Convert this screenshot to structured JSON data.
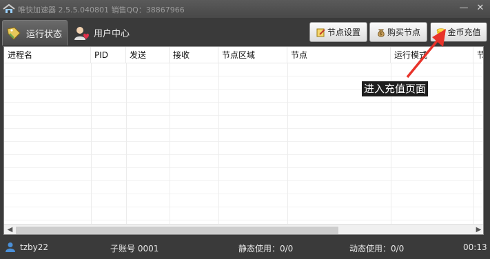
{
  "window": {
    "title": "唯快加速器 2.5.5.040801  销售QQ：38867966",
    "minimize_glyph": "—",
    "close_glyph": "✕"
  },
  "tabs": [
    {
      "label": "运行状态",
      "icon": "tag-icon",
      "active": true
    },
    {
      "label": "用户中心",
      "icon": "user-heart-icon",
      "active": false
    }
  ],
  "toolbar": {
    "node_settings": "节点设置",
    "buy_nodes": "购买节点",
    "gold_recharge": "金币充值"
  },
  "table": {
    "columns": [
      "进程名",
      "PID",
      "发送",
      "接收",
      "节点区域",
      "节点",
      "运行模式",
      "节"
    ],
    "rows": []
  },
  "annotation": {
    "text": "进入充值页面"
  },
  "status": {
    "username": "tzby22",
    "sub_account": "子账号 0001",
    "static_usage": "静态使用：0/0",
    "dynamic_usage": "动态使用：0/0",
    "time": "00:13"
  },
  "colors": {
    "window_bg": "#3a3a3a",
    "annotation_arrow": "#e8332a",
    "annotation_bg": "#1e1e1e"
  }
}
